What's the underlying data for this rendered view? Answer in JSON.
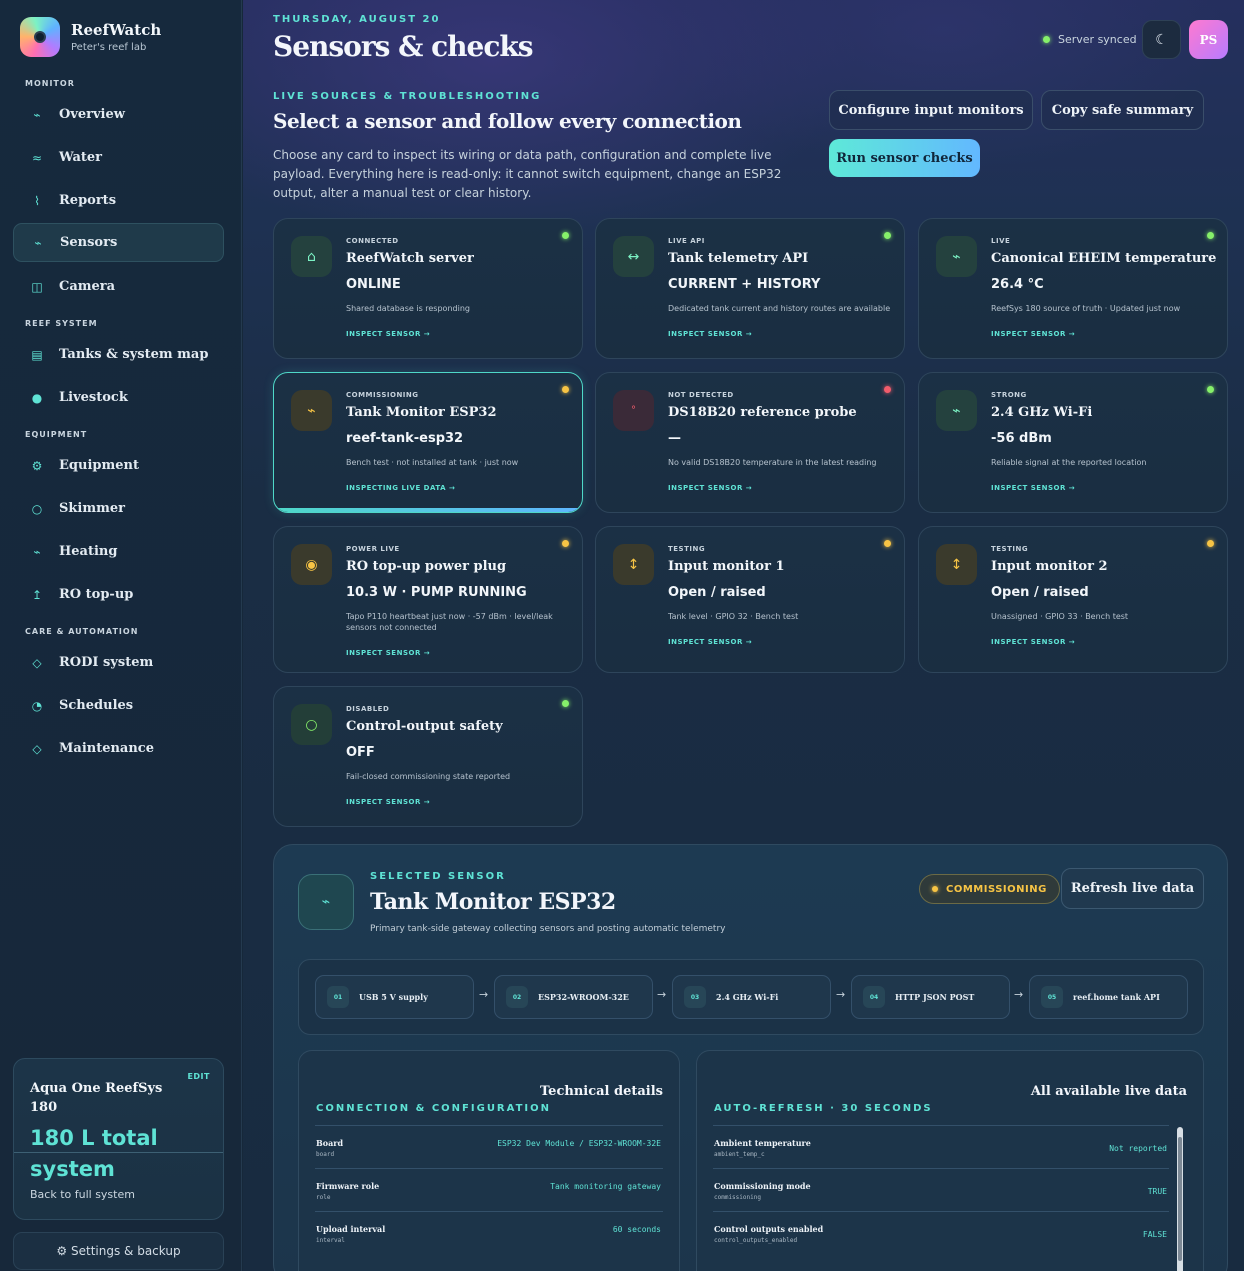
{
  "app": {
    "name": "ReefWatch",
    "subtitle": "Peter's reef lab"
  },
  "nav": {
    "sections": [
      "MONITOR",
      "REEF SYSTEM",
      "EQUIPMENT",
      "CARE & AUTOMATION"
    ],
    "items": [
      {
        "label": "Overview",
        "icon": "pulse-icon",
        "glyph": "⌁"
      },
      {
        "label": "Water",
        "icon": "waves-icon",
        "glyph": "≈"
      },
      {
        "label": "Reports",
        "icon": "chart-icon",
        "glyph": "⌇"
      },
      {
        "label": "Sensors",
        "icon": "pulse-icon",
        "glyph": "⌁",
        "active": true
      },
      {
        "label": "Camera",
        "icon": "camera-icon",
        "glyph": "◫"
      },
      {
        "label": "Tanks & system map",
        "icon": "tank-icon",
        "glyph": "▤"
      },
      {
        "label": "Livestock",
        "icon": "fish-icon",
        "glyph": "●"
      },
      {
        "label": "Equipment",
        "icon": "gear-icon",
        "glyph": "⚙"
      },
      {
        "label": "Skimmer",
        "icon": "ring-icon",
        "glyph": "○"
      },
      {
        "label": "Heating",
        "icon": "heat-icon",
        "glyph": "⌁"
      },
      {
        "label": "RO top-up",
        "icon": "arrow-up-icon",
        "glyph": "↥"
      },
      {
        "label": "RODI system",
        "icon": "diamond-icon",
        "glyph": "◇"
      },
      {
        "label": "Schedules",
        "icon": "clock-icon",
        "glyph": "◔"
      },
      {
        "label": "Maintenance",
        "icon": "diamond-icon",
        "glyph": "◇"
      }
    ]
  },
  "tank": {
    "name": "Aqua One ReefSys 180",
    "edit": "EDIT",
    "total": "180 L total system",
    "back": "Back to full system"
  },
  "settings": {
    "label": "⚙ Settings & backup"
  },
  "header": {
    "date": "THURSDAY, AUGUST 20",
    "title": "Sensors & checks",
    "sync": "Server synced",
    "theme_glyph": "☾",
    "avatar": "PS"
  },
  "intro": {
    "eyebrow": "LIVE SOURCES & TROUBLESHOOTING",
    "title": "Select a sensor and follow every connection",
    "desc": "Choose any card to inspect its wiring or data path, configuration and complete live payload. Everything here is read-only: it cannot switch equipment, change an ESP32 output, alter a manual test or clear history.",
    "btn_config": "Configure input monitors",
    "btn_copy": "Copy safe summary",
    "btn_run": "Run sensor checks"
  },
  "sensors": [
    {
      "status": "CONNECTED",
      "name": "ReefWatch server",
      "value": "ONLINE",
      "desc": "Shared database is responding",
      "link": "INSPECT SENSOR →",
      "dot": "green",
      "icon": "home-icon",
      "glyph": "⌂",
      "tone": ""
    },
    {
      "status": "LIVE API",
      "name": "Tank telemetry API",
      "value": "CURRENT + HISTORY",
      "desc": "Dedicated tank current and history routes are available",
      "link": "INSPECT SENSOR →",
      "dot": "green",
      "icon": "swap-icon",
      "glyph": "↔",
      "tone": ""
    },
    {
      "status": "LIVE",
      "name": "Canonical EHEIM temperature",
      "value": "26.4 °C",
      "desc": "ReefSys 180 source of truth · Updated just now",
      "link": "INSPECT SENSOR →",
      "dot": "green",
      "icon": "pulse-icon",
      "glyph": "⌁",
      "tone": ""
    },
    {
      "status": "COMMISSIONING",
      "name": "Tank Monitor ESP32",
      "value": "reef-tank-esp32",
      "desc": "Bench test · not installed at tank · just now",
      "link": "INSPECTING LIVE DATA →",
      "dot": "amber",
      "icon": "chip-icon",
      "glyph": "⌁",
      "tone": "amber",
      "selected": true
    },
    {
      "status": "NOT DETECTED",
      "name": "DS18B20 reference probe",
      "value": "—",
      "desc": "No valid DS18B20 temperature in the latest reading",
      "link": "INSPECT SENSOR →",
      "dot": "red",
      "icon": "probe-icon",
      "glyph": "°",
      "tone": "red"
    },
    {
      "status": "STRONG",
      "name": "2.4 GHz Wi-Fi",
      "value": "-56 dBm",
      "desc": "Reliable signal at the reported location",
      "link": "INSPECT SENSOR →",
      "dot": "green",
      "icon": "wifi-icon",
      "glyph": "⌁",
      "tone": ""
    },
    {
      "status": "POWER LIVE",
      "name": "RO top-up power plug",
      "value": "10.3 W · PUMP RUNNING",
      "desc": "Tapo P110 heartbeat just now · -57 dBm · level/leak sensors not connected",
      "link": "INSPECT SENSOR →",
      "dot": "amber",
      "icon": "plug-icon",
      "glyph": "◉",
      "tone": "amber"
    },
    {
      "status": "TESTING",
      "name": "Input monitor 1",
      "value": "Open / raised",
      "desc": "Tank level · GPIO 32 · Bench test",
      "link": "INSPECT SENSOR →",
      "dot": "amber",
      "icon": "updown-icon",
      "glyph": "↕",
      "tone": "amber"
    },
    {
      "status": "TESTING",
      "name": "Input monitor 2",
      "value": "Open / raised",
      "desc": "Unassigned · GPIO 33 · Bench test",
      "link": "INSPECT SENSOR →",
      "dot": "amber",
      "icon": "updown-icon",
      "glyph": "↕",
      "tone": "amber"
    },
    {
      "status": "DISABLED",
      "name": "Control-output safety",
      "value": "OFF",
      "desc": "Fail-closed commissioning state reported",
      "link": "INSPECT SENSOR →",
      "dot": "green",
      "icon": "circle-icon",
      "glyph": "○",
      "tone": "green"
    }
  ],
  "detail": {
    "eyebrow": "SELECTED SENSOR",
    "title": "Tank Monitor ESP32",
    "desc": "Primary tank-side gateway collecting sensors and posting automatic telemetry",
    "badge": "COMMISSIONING",
    "refresh": "Refresh live data",
    "chain": [
      {
        "num": "01",
        "label": "USB 5 V supply"
      },
      {
        "num": "02",
        "label": "ESP32-WROOM-32E"
      },
      {
        "num": "03",
        "label": "2.4 GHz Wi-Fi"
      },
      {
        "num": "04",
        "label": "HTTP JSON POST"
      },
      {
        "num": "05",
        "label": "reef.home tank API"
      }
    ],
    "technical": {
      "title": "Technical details",
      "eyebrow": "CONNECTION & CONFIGURATION",
      "rows": [
        {
          "label": "Board",
          "key": "board",
          "value": "ESP32 Dev Module / ESP32-WROOM-32E"
        },
        {
          "label": "Firmware role",
          "key": "role",
          "value": "Tank monitoring gateway"
        },
        {
          "label": "Upload interval",
          "key": "interval",
          "value": "60 seconds"
        }
      ]
    },
    "live": {
      "title": "All available live data",
      "eyebrow": "AUTO-REFRESH · 30 SECONDS",
      "rows": [
        {
          "label": "Ambient temperature",
          "key": "ambient_temp_c",
          "value": "Not reported"
        },
        {
          "label": "Commissioning mode",
          "key": "commissioning",
          "value": "TRUE"
        },
        {
          "label": "Control outputs enabled",
          "key": "control_outputs_enabled",
          "value": "FALSE"
        }
      ]
    }
  }
}
